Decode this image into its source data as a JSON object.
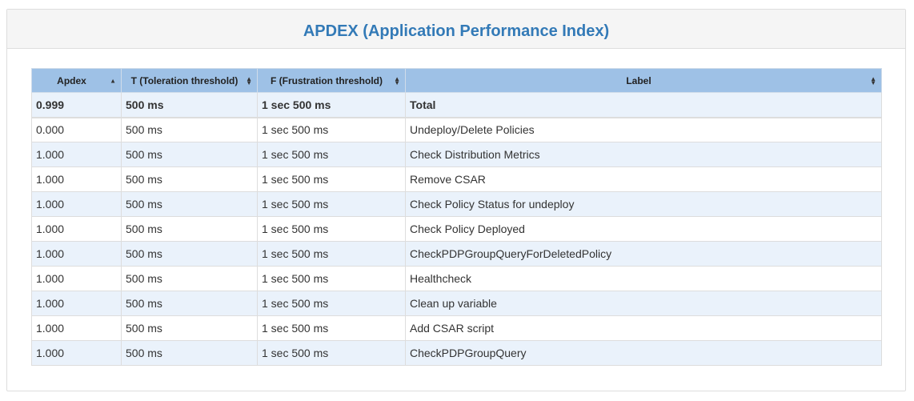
{
  "title": "APDEX (Application Performance Index)",
  "columns": [
    {
      "label": "Apdex",
      "sort": "asc"
    },
    {
      "label": "T (Toleration threshold)",
      "sort": "both"
    },
    {
      "label": "F (Frustration threshold)",
      "sort": "both"
    },
    {
      "label": "Label",
      "sort": "both"
    }
  ],
  "total": {
    "apdex": "0.999",
    "t": "500 ms",
    "f": "1 sec 500 ms",
    "label": "Total"
  },
  "rows": [
    {
      "apdex": "0.000",
      "t": "500 ms",
      "f": "1 sec 500 ms",
      "label": "Undeploy/Delete Policies"
    },
    {
      "apdex": "1.000",
      "t": "500 ms",
      "f": "1 sec 500 ms",
      "label": "Check Distribution Metrics"
    },
    {
      "apdex": "1.000",
      "t": "500 ms",
      "f": "1 sec 500 ms",
      "label": "Remove CSAR"
    },
    {
      "apdex": "1.000",
      "t": "500 ms",
      "f": "1 sec 500 ms",
      "label": "Check Policy Status for undeploy"
    },
    {
      "apdex": "1.000",
      "t": "500 ms",
      "f": "1 sec 500 ms",
      "label": "Check Policy Deployed"
    },
    {
      "apdex": "1.000",
      "t": "500 ms",
      "f": "1 sec 500 ms",
      "label": "CheckPDPGroupQueryForDeletedPolicy"
    },
    {
      "apdex": "1.000",
      "t": "500 ms",
      "f": "1 sec 500 ms",
      "label": "Healthcheck"
    },
    {
      "apdex": "1.000",
      "t": "500 ms",
      "f": "1 sec 500 ms",
      "label": "Clean up variable"
    },
    {
      "apdex": "1.000",
      "t": "500 ms",
      "f": "1 sec 500 ms",
      "label": "Add CSAR script"
    },
    {
      "apdex": "1.000",
      "t": "500 ms",
      "f": "1 sec 500 ms",
      "label": "CheckPDPGroupQuery"
    }
  ],
  "colors": {
    "title": "#337ab7",
    "header_bg": "#9ec1e6",
    "stripe": "#eaf2fb"
  }
}
